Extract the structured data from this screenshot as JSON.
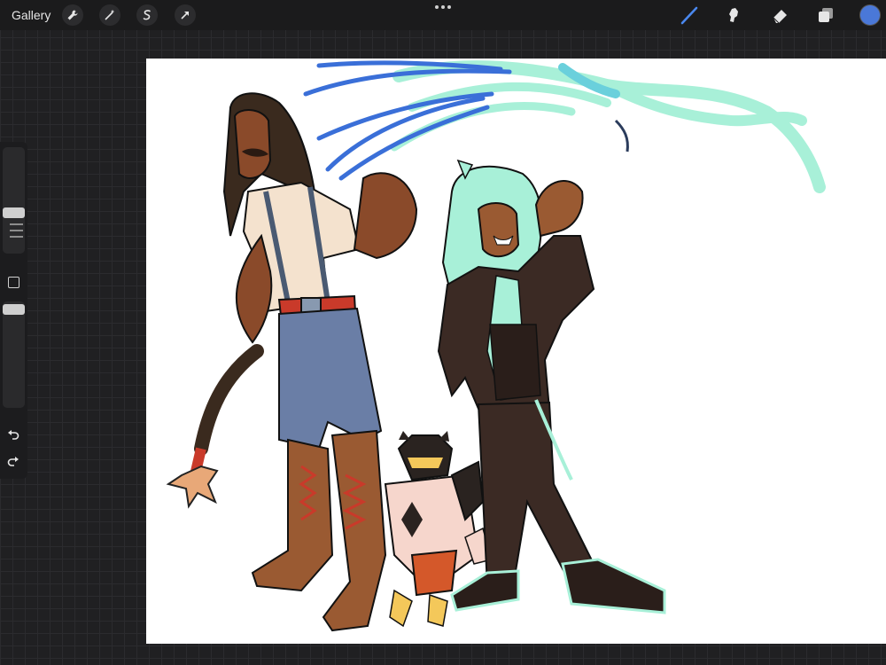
{
  "toolbar": {
    "gallery_label": "Gallery",
    "left_tools": [
      "wrench-icon",
      "magic-wand-icon",
      "selection-icon",
      "transform-arrow-icon"
    ],
    "right_tools": [
      "brush-icon",
      "smudge-icon",
      "eraser-icon",
      "layers-icon"
    ],
    "active_tool": "brush-icon",
    "current_color": "#4a78d8"
  },
  "sidebar": {
    "brush_size_level": 0.63,
    "opacity_level": 0.0,
    "controls": [
      "brush-size-slider",
      "modify-button",
      "opacity-slider",
      "undo-icon",
      "redo-icon"
    ]
  },
  "canvas": {
    "content": "illustration-artwork",
    "background": "#ffffff"
  },
  "colors": {
    "accent_blue": "#3a6fd8",
    "mint": "#a8f0d8",
    "skin_brown": "#8a4a2a",
    "denim": "#6a7ea6",
    "suit_brown": "#3b2a24"
  }
}
